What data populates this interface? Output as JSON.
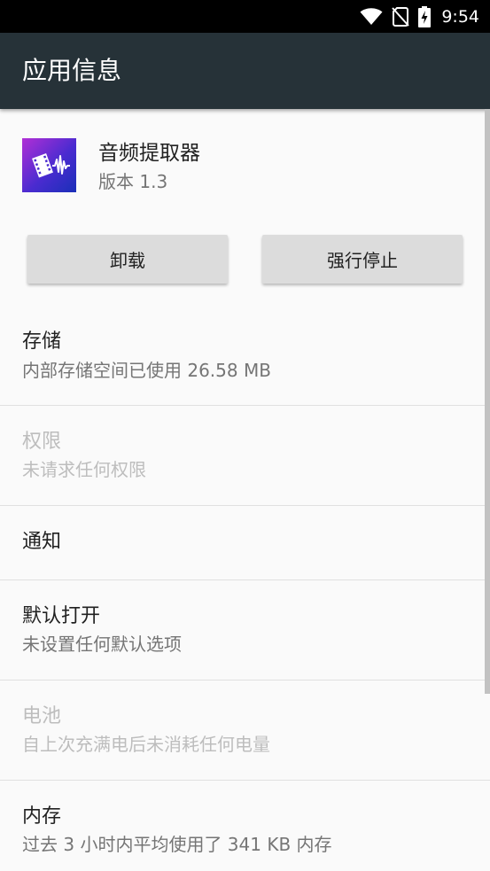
{
  "status_bar": {
    "time": "9:54",
    "icons": [
      "wifi-icon",
      "no-sim-icon",
      "battery-charging-icon"
    ]
  },
  "app_bar": {
    "title": "应用信息"
  },
  "app": {
    "name": "音频提取器",
    "version": "版本 1.3",
    "icon": "audio-extractor-app-icon"
  },
  "actions": {
    "uninstall": "卸载",
    "force_stop": "强行停止"
  },
  "prefs": {
    "storage": {
      "title": "存储",
      "summary": "内部存储空间已使用 26.58 MB"
    },
    "permissions": {
      "title": "权限",
      "summary": "未请求任何权限"
    },
    "notifications": {
      "title": "通知"
    },
    "open_by_default": {
      "title": "默认打开",
      "summary": "未设置任何默认选项"
    },
    "battery": {
      "title": "电池",
      "summary": "自上次充满电后未消耗任何电量"
    },
    "memory": {
      "title": "内存",
      "summary": "过去 3 小时内平均使用了 341 KB 内存"
    }
  },
  "colors": {
    "app_bar": "#263238",
    "status_bar": "#000000",
    "background": "#fafafa",
    "button": "#dcdcdc",
    "disabled_text": "#bdbdbd"
  }
}
